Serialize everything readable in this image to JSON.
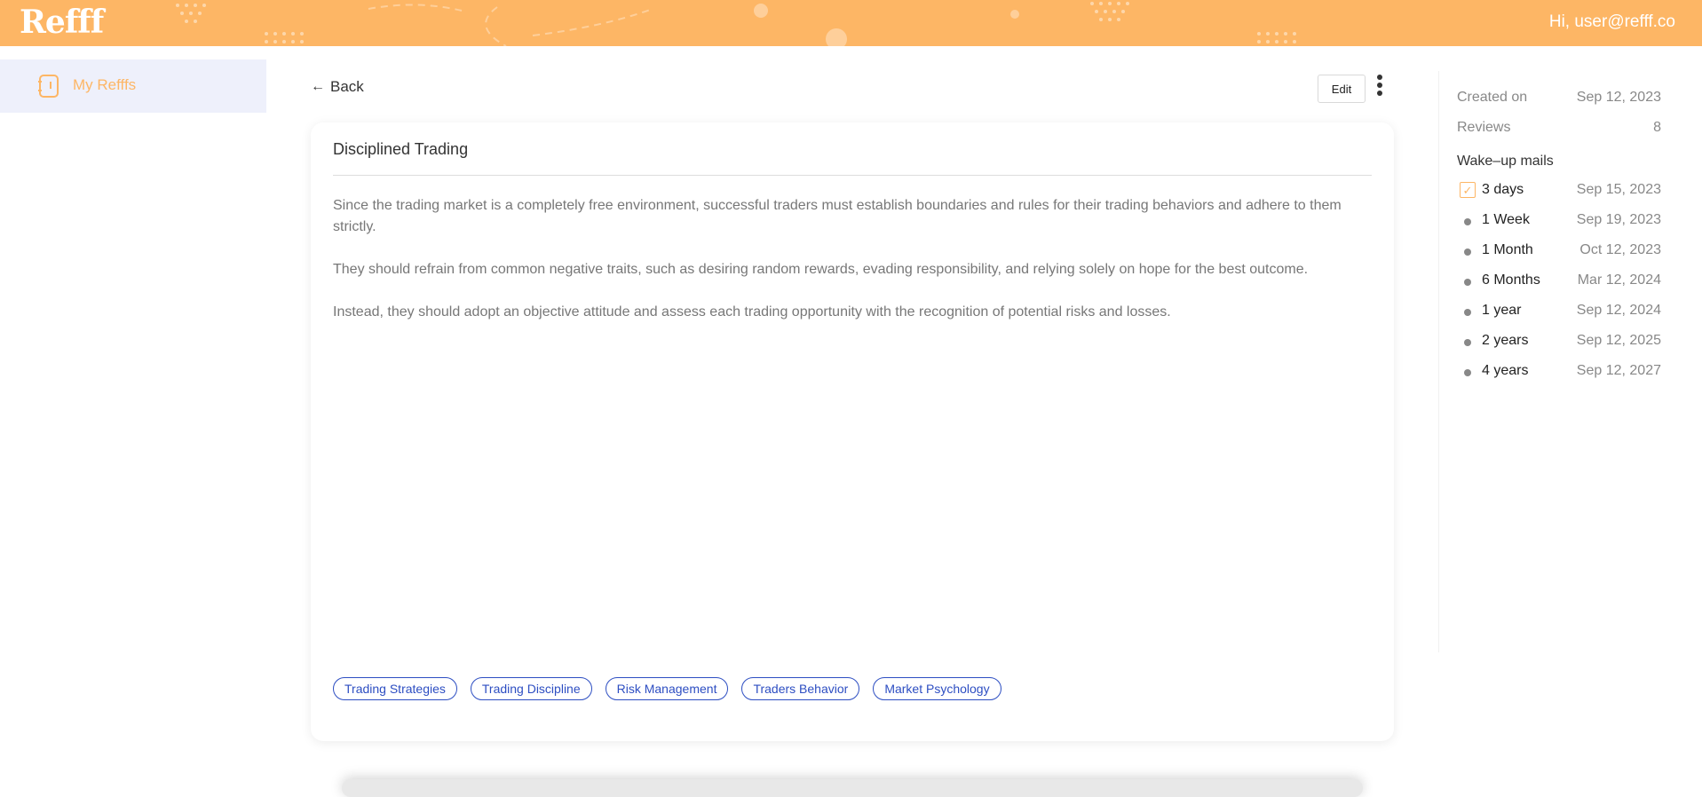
{
  "header": {
    "logo": "Refff",
    "greeting": "Hi, user@refff.co"
  },
  "sidebar": {
    "items": [
      {
        "label": "My Refffs",
        "icon": "notebook-icon"
      }
    ]
  },
  "toolbar": {
    "back_label": "Back",
    "edit_label": "Edit"
  },
  "card": {
    "title": "Disciplined Trading",
    "paragraphs": [
      "Since the trading market is a completely free environment, successful traders must establish boundaries and rules for their trading behaviors and adhere to them strictly.",
      "They should refrain from common negative traits, such as desiring random rewards, evading responsibility, and relying solely on hope for the best outcome.",
      "Instead, they should adopt an objective attitude and assess each trading opportunity with the recognition of potential risks and losses."
    ],
    "tags": [
      "Trading Strategies",
      "Trading Discipline",
      "Risk Management",
      "Traders Behavior",
      "Market Psychology"
    ]
  },
  "details": {
    "created_label": "Created on",
    "created_value": "Sep 12, 2023",
    "reviews_label": "Reviews",
    "reviews_value": "8",
    "wake_title": "Wake–up mails",
    "wake_items": [
      {
        "label": "3 days",
        "date": "Sep 15, 2023",
        "status": "checked"
      },
      {
        "label": "1 Week",
        "date": "Sep 19, 2023",
        "status": "pending"
      },
      {
        "label": "1 Month",
        "date": "Oct 12, 2023",
        "status": "pending"
      },
      {
        "label": "6 Months",
        "date": "Mar 12, 2024",
        "status": "pending"
      },
      {
        "label": "1 year",
        "date": "Sep 12, 2024",
        "status": "pending"
      },
      {
        "label": "2 years",
        "date": "Sep 12, 2025",
        "status": "pending"
      },
      {
        "label": "4 years",
        "date": "Sep 12, 2027",
        "status": "pending"
      }
    ]
  },
  "colors": {
    "accent": "#fdb665",
    "tag_blue": "#2d4ec2",
    "sidebar_active_bg": "#eef0fb"
  }
}
